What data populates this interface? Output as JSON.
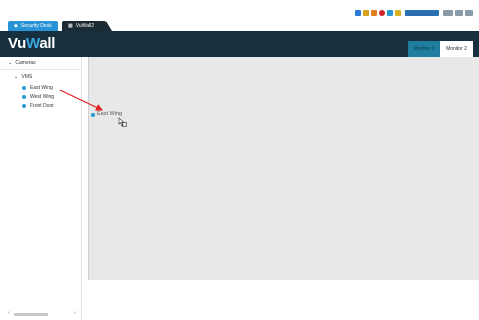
{
  "tabs": [
    {
      "label": "Security Desk"
    },
    {
      "label": "VuWall2"
    }
  ],
  "header": {
    "logo_part1": "Vu",
    "logo_part2": "W",
    "logo_part3": "all",
    "monitor_tabs": [
      {
        "label": "Monitor 1"
      },
      {
        "label": "Monitor 2"
      }
    ]
  },
  "sidebar": {
    "root": "Cameras",
    "group": "VMS",
    "cameras": [
      {
        "label": "East Wing"
      },
      {
        "label": "West Wing"
      },
      {
        "label": "Front Door"
      }
    ]
  },
  "canvas": {
    "dropped_item": "East Wing"
  },
  "colors": {
    "header_bg": "#163040",
    "accent": "#2a93d5",
    "arrow": "#e02020"
  }
}
